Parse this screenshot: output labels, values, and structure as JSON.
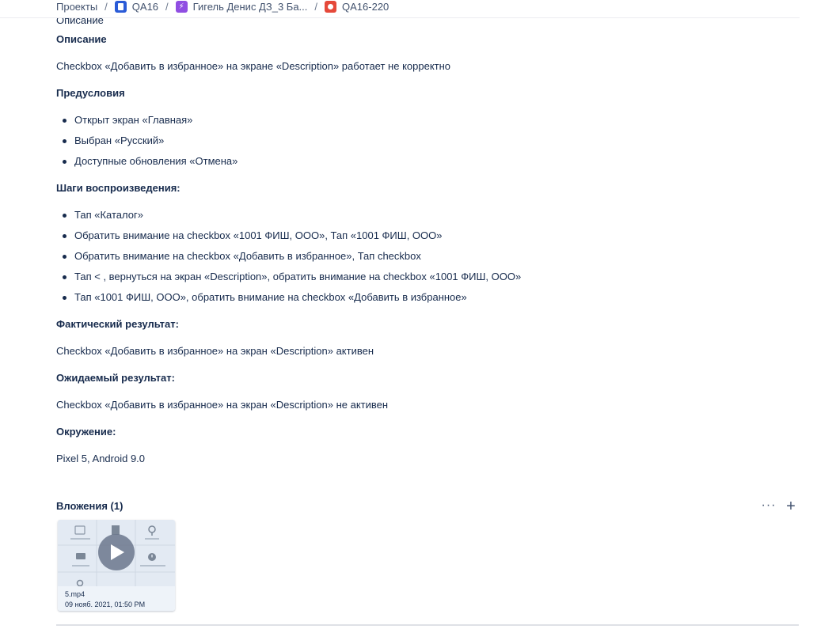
{
  "breadcrumbs": [
    {
      "label": "Проекты"
    },
    {
      "label": "QA16"
    },
    {
      "label": "Гигель Денис ДЗ_3 Ба..."
    },
    {
      "label": "QA16-220"
    }
  ],
  "ghost_heading": "Описание",
  "description": {
    "heading": "Описание",
    "text": "Checkbox «Добавить в избранное» на экране «Description» работает не корректно",
    "preconditions": {
      "heading": "Предусловия",
      "items": [
        "Открыт экран «Главная»",
        "Выбран «Русский»",
        "Доступные обновления «Отмена»"
      ]
    },
    "steps": {
      "heading": "Шаги воспроизведения:",
      "items": [
        "Тап «Каталог»",
        "Обратить внимание на checkbox «1001 ФИШ, ООО», Тап «1001 ФИШ, ООО»",
        "Обратить внимание на checkbox «Добавить в избранное», Тап checkbox",
        "Тап  < , вернуться на экран «Description», обратить внимание на checkbox «1001 ФИШ, ООО»",
        "Тап «1001 ФИШ, ООО», обратить внимание на checkbox «Добавить в избранное»"
      ]
    },
    "actual": {
      "heading": "Фактический результат:",
      "text": "Checkbox «Добавить в избранное» на экран «Description» активен"
    },
    "expected": {
      "heading": "Ожидаемый результат:",
      "text": "Checkbox «Добавить в избранное» на экран «Description» не активен"
    },
    "environment": {
      "heading": "Окружение:",
      "text": "Pixel 5, Android 9.0"
    }
  },
  "attachments": {
    "title": "Вложения (1)",
    "more_label": "···",
    "add_label": "+",
    "items": [
      {
        "filename": "5.mp4",
        "date": "09 нояб. 2021, 01:50 PM",
        "type": "video"
      }
    ]
  },
  "colors": {
    "text": "#172b4d",
    "muted": "#5e6c84",
    "project_icon": "#2a5bd7",
    "epic_icon": "#904ee2",
    "bug_icon": "#e5493a"
  }
}
